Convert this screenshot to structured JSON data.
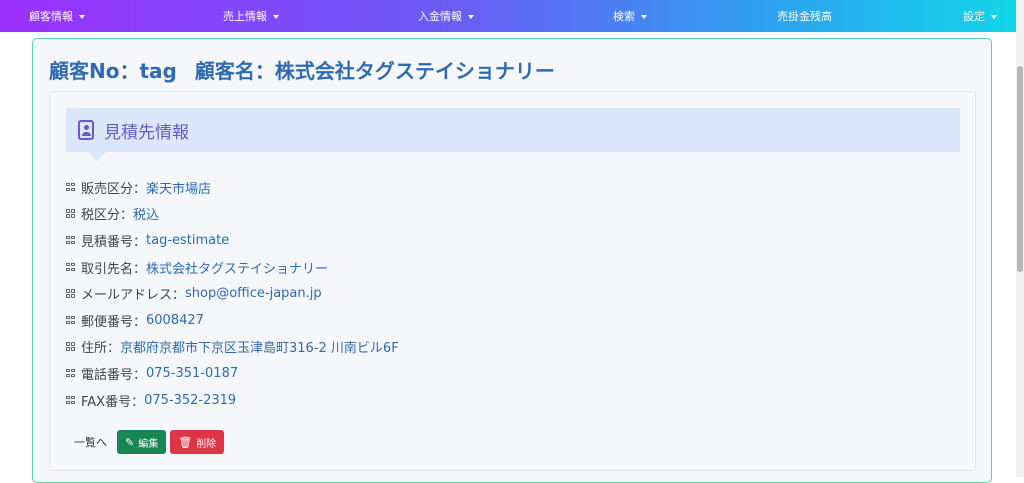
{
  "nav": {
    "items": [
      {
        "label": "顧客情報",
        "dropdown": true
      },
      {
        "label": "売上情報",
        "dropdown": true
      },
      {
        "label": "入金情報",
        "dropdown": true
      },
      {
        "label": "検索",
        "dropdown": true
      },
      {
        "label": "売掛金残高",
        "dropdown": false
      },
      {
        "label": "設定",
        "dropdown": true
      }
    ]
  },
  "header": {
    "customer_no": "顧客No：tag",
    "customer_name": "顧客名：株式会社タグステイショナリー"
  },
  "section": {
    "icon": "contact-card-icon",
    "title": "見積先情報"
  },
  "fields": [
    {
      "label": "販売区分：",
      "value": "楽天市場店"
    },
    {
      "label": "税区分：",
      "value": "税込"
    },
    {
      "label": "見積番号：",
      "value": "tag-estimate"
    },
    {
      "label": "取引先名：",
      "value": "株式会社タグステイショナリー"
    },
    {
      "label": "メールアドレス：",
      "value": "shop@office-japan.jp"
    },
    {
      "label": "郵便番号：",
      "value": "6008427"
    },
    {
      "label": "住所：",
      "value": "京都府京都市下京区玉津島町316-2 川南ビル6F"
    },
    {
      "label": "電話番号：",
      "value": "075-351-0187"
    },
    {
      "label": "FAX番号：",
      "value": "075-352-2319"
    }
  ],
  "actions": {
    "back_label": "一覧へ",
    "edit_label": "編集",
    "delete_label": "削除"
  },
  "colors": {
    "accent": "#2e6bb3",
    "section_title": "#6a5ac8",
    "edit": "#198754",
    "delete": "#dc3545"
  }
}
